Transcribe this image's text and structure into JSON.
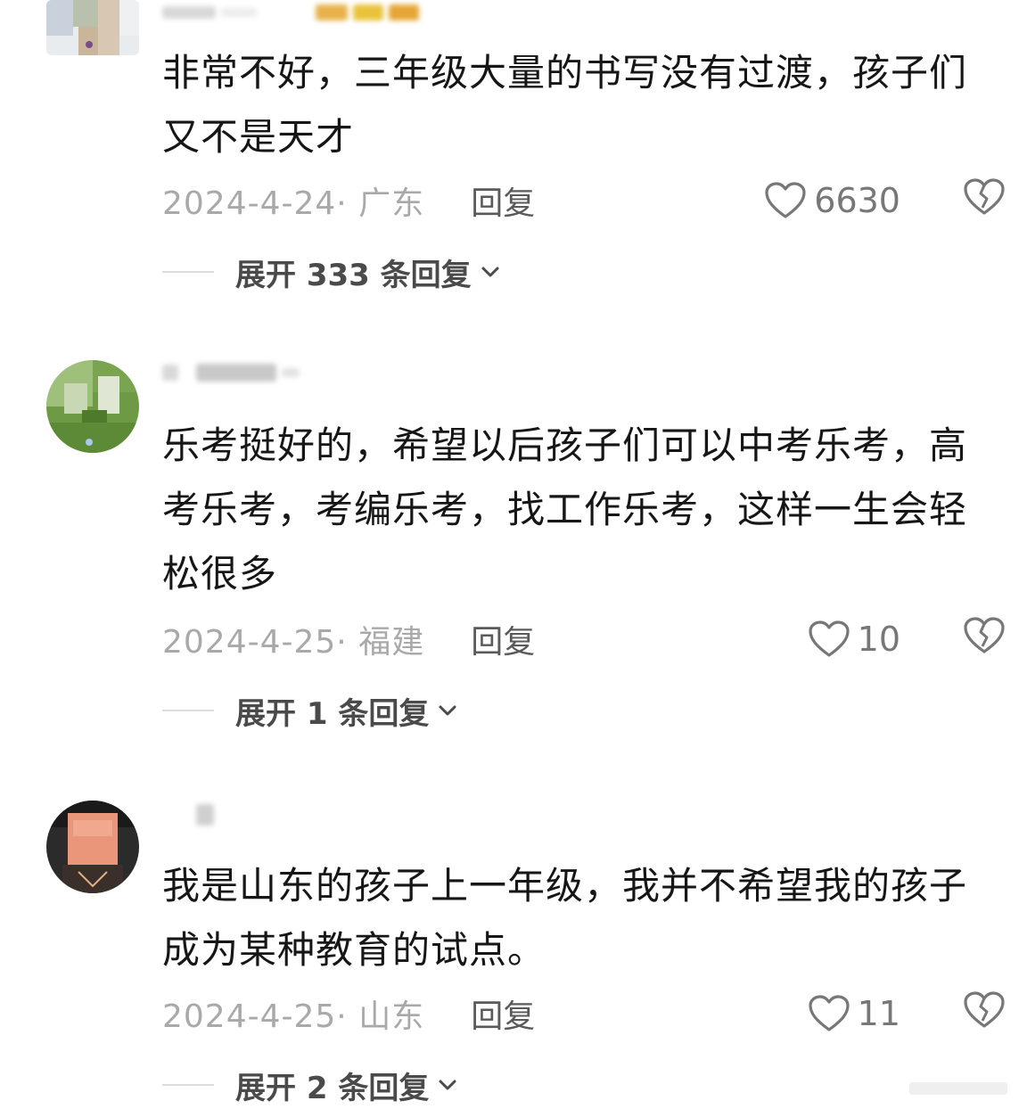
{
  "comments": [
    {
      "text": "非常不好，三年级大量的书写没有过渡，孩子们又不是天才",
      "date_location": "2024-4-24· 广东",
      "reply_label": "回复",
      "likes": "6630",
      "expand_label": "展开 333 条回复"
    },
    {
      "text": "乐考挺好的，希望以后孩子们可以中考乐考，高考乐考，考编乐考，找工作乐考，这样一生会轻松很多",
      "date_location": "2024-4-25· 福建",
      "reply_label": "回复",
      "likes": "10",
      "expand_label": "展开 1 条回复"
    },
    {
      "text": "我是山东的孩子上一年级，我并不希望我的孩子成为某种教育的试点。",
      "date_location": "2024-4-25· 山东",
      "reply_label": "回复",
      "likes": "11",
      "expand_label": "展开 2 条回复"
    }
  ],
  "icons": {
    "like": "heart-outline-icon",
    "dislike": "broken-heart-icon",
    "expand": "chevron-down-icon"
  },
  "colors": {
    "text": "#161616",
    "meta": "#a9a9a9",
    "reply": "#5a5a5a",
    "expand": "#4a4a4a",
    "icon": "#777777"
  }
}
